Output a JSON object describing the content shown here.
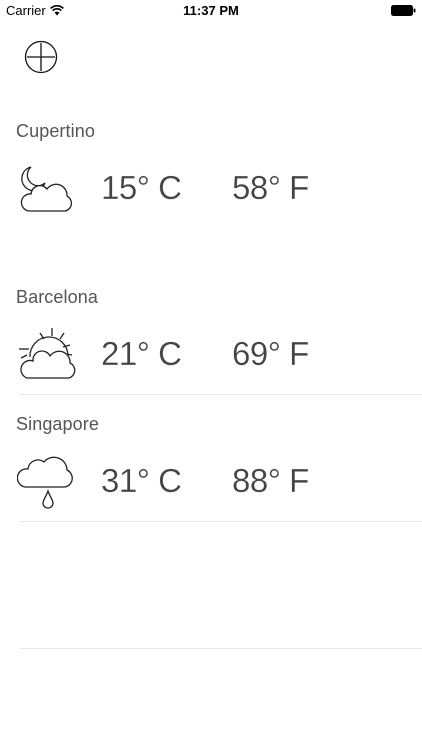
{
  "status_bar": {
    "carrier": "Carrier",
    "time": "11:37 PM",
    "wifi_icon": "wifi-icon",
    "battery_icon": "battery-icon"
  },
  "toolbar": {
    "add_icon": "add-circle-icon"
  },
  "cities": [
    {
      "name": "Cupertino",
      "icon": "moon-cloud-icon",
      "celsius": "15° C",
      "fahrenheit": "58° F"
    },
    {
      "name": "Barcelona",
      "icon": "sun-cloud-icon",
      "celsius": "21° C",
      "fahrenheit": "69° F"
    },
    {
      "name": "Singapore",
      "icon": "rain-cloud-icon",
      "celsius": "31° C",
      "fahrenheit": "88° F"
    }
  ],
  "colors": {
    "text": "#444444",
    "city_label": "#555555",
    "divider": "#e6e6e6",
    "background": "#ffffff"
  }
}
